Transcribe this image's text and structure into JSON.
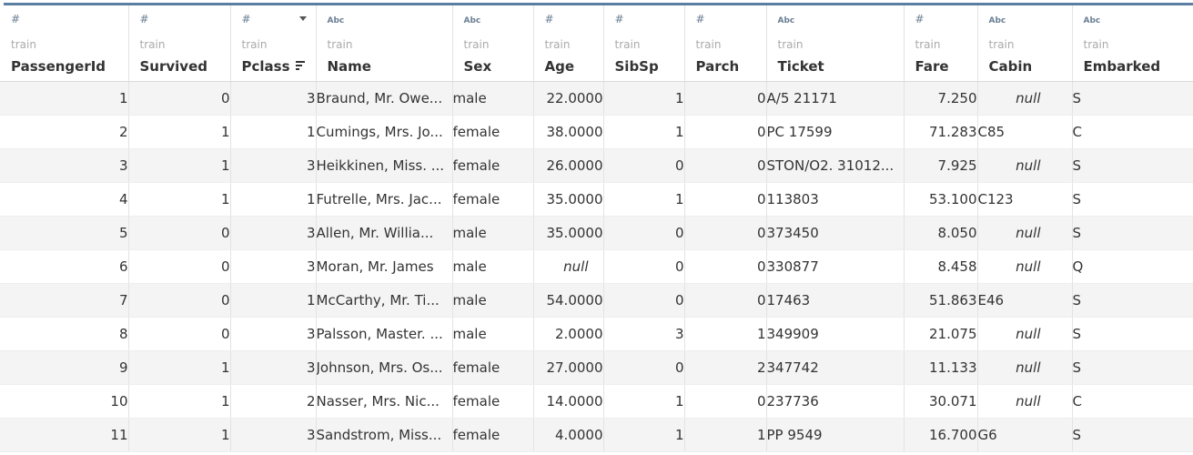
{
  "table": {
    "columns": [
      {
        "key": "PassengerId",
        "type_icon": "#",
        "source": "train",
        "name": "PassengerId"
      },
      {
        "key": "Survived",
        "type_icon": "#",
        "source": "train",
        "name": "Survived"
      },
      {
        "key": "Pclass",
        "type_icon": "#",
        "source": "train",
        "name": "Pclass"
      },
      {
        "key": "Name",
        "type_icon": "Abc",
        "source": "train",
        "name": "Name"
      },
      {
        "key": "Sex",
        "type_icon": "Abc",
        "source": "train",
        "name": "Sex"
      },
      {
        "key": "Age",
        "type_icon": "#",
        "source": "train",
        "name": "Age"
      },
      {
        "key": "SibSp",
        "type_icon": "#",
        "source": "train",
        "name": "SibSp"
      },
      {
        "key": "Parch",
        "type_icon": "#",
        "source": "train",
        "name": "Parch"
      },
      {
        "key": "Ticket",
        "type_icon": "Abc",
        "source": "train",
        "name": "Ticket"
      },
      {
        "key": "Fare",
        "type_icon": "#",
        "source": "train",
        "name": "Fare"
      },
      {
        "key": "Cabin",
        "type_icon": "Abc",
        "source": "train",
        "name": "Cabin"
      },
      {
        "key": "Embarked",
        "type_icon": "Abc",
        "source": "train",
        "name": "Embarked"
      }
    ],
    "rows": [
      [
        "1",
        "0",
        "3",
        "Braund, Mr. Owe...",
        "male",
        "22.0000",
        "1",
        "0",
        "A/5 21171",
        "7.250",
        "null",
        "S"
      ],
      [
        "2",
        "1",
        "1",
        "Cumings, Mrs. Jo...",
        "female",
        "38.0000",
        "1",
        "0",
        "PC 17599",
        "71.283",
        "C85",
        "C"
      ],
      [
        "3",
        "1",
        "3",
        "Heikkinen, Miss. ...",
        "female",
        "26.0000",
        "0",
        "0",
        "STON/O2. 31012...",
        "7.925",
        "null",
        "S"
      ],
      [
        "4",
        "1",
        "1",
        "Futrelle, Mrs. Jac...",
        "female",
        "35.0000",
        "1",
        "0",
        "113803",
        "53.100",
        "C123",
        "S"
      ],
      [
        "5",
        "0",
        "3",
        "Allen, Mr. Willia...",
        "male",
        "35.0000",
        "0",
        "0",
        "373450",
        "8.050",
        "null",
        "S"
      ],
      [
        "6",
        "0",
        "3",
        "Moran, Mr. James",
        "male",
        "null",
        "0",
        "0",
        "330877",
        "8.458",
        "null",
        "Q"
      ],
      [
        "7",
        "0",
        "1",
        "McCarthy, Mr. Ti...",
        "male",
        "54.0000",
        "0",
        "0",
        "17463",
        "51.863",
        "E46",
        "S"
      ],
      [
        "8",
        "0",
        "3",
        "Palsson, Master. ...",
        "male",
        "2.0000",
        "3",
        "1",
        "349909",
        "21.075",
        "null",
        "S"
      ],
      [
        "9",
        "1",
        "3",
        "Johnson, Mrs. Os...",
        "female",
        "27.0000",
        "0",
        "2",
        "347742",
        "11.133",
        "null",
        "S"
      ],
      [
        "10",
        "1",
        "2",
        "Nasser, Mrs. Nic...",
        "female",
        "14.0000",
        "1",
        "0",
        "237736",
        "30.071",
        "null",
        "C"
      ],
      [
        "11",
        "1",
        "3",
        "Sandstrom, Miss...",
        "female",
        "4.0000",
        "1",
        "1",
        "PP 9549",
        "16.700",
        "G6",
        "S"
      ]
    ]
  },
  "icons": {
    "numeric_type": "hash-icon",
    "string_type": "abc-icon",
    "sort": "sort-descending-icon",
    "column_menu": "chevron-down-icon"
  },
  "colors": {
    "accent_bar": "#5a7fa0",
    "type_icon": "#6a7f94",
    "null_text": "#9a9a9a",
    "alt_row": "#f4f4f4",
    "highlight_value": "#1f5fa8"
  }
}
